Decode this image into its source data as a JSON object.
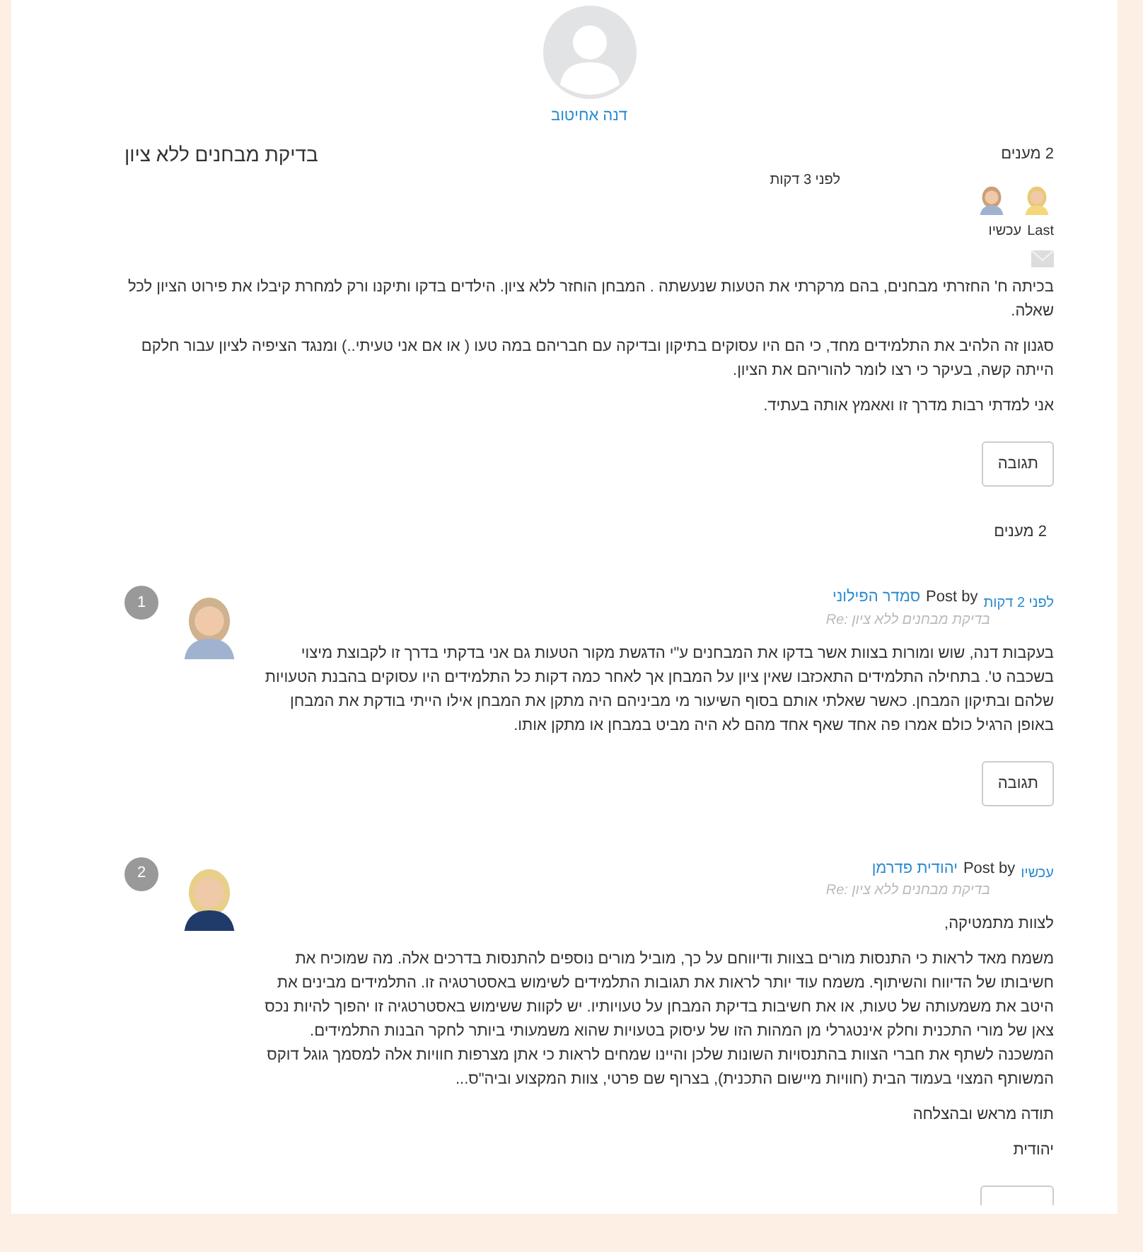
{
  "topic": {
    "author_name": "דנה אחיטוב",
    "title": "בדיקת מבחנים ללא ציון",
    "replies_count": "2 מענים",
    "time": "לפני 3 דקות",
    "last_label": "Last",
    "last_time": "עכשיו",
    "paragraphs": [
      "בכיתה ח' החזרתי מבחנים, בהם מרקרתי את הטעות שנעשתה . המבחן הוחזר ללא ציון. הילדים בדקו ותיקנו ורק למחרת קיבלו את פירוט הציון לכל שאלה.",
      "סגנון זה הלהיב את התלמידים מחד, כי הם היו עסוקים בתיקון ובדיקה עם חבריהם במה טעו ( או אם אני טעיתי..) ומנגד הציפיה לציון עבור חלקם הייתה קשה, בעיקר כי רצו לומר להוריהם את הציון.",
      "אני למדתי רבות מדרך זו ואאמץ אותה בעתיד."
    ],
    "reply_button": "תגובה"
  },
  "replies_heading": "2 מענים",
  "posts": [
    {
      "number": "1",
      "time": "לפני 2 דקות",
      "by": "Post by",
      "author": "סמדר הפילוני",
      "subject": "Re: בדיקת מבחנים ללא ציון",
      "paragraphs": [
        "בעקבות דנה, שוש ומורות בצוות אשר בדקו את המבחנים ע\"י הדגשת מקור הטעות גם אני בדקתי בדרך זו לקבוצת מיצוי בשכבה ט'. בתחילה התלמידים התאכזבו שאין ציון על המבחן אך לאחר כמה דקות כל התלמידים היו עסוקים בהבנת הטעויות שלהם ובתיקון המבחן. כאשר שאלתי אותם בסוף השיעור מי מביניהם  היה מתקן את המבחן אילו הייתי בודקת את המבחן באופן הרגיל כולם אמרו פה אחד שאף אחד מהם לא היה מביט במבחן או מתקן אותו."
      ],
      "reply_button": "תגובה"
    },
    {
      "number": "2",
      "time": "עכשיו",
      "by": "Post by",
      "author": "יהודית פדרמן",
      "subject": "Re: בדיקת מבחנים ללא ציון",
      "paragraphs": [
        "לצוות מתמטיקה,",
        "משמח מאד לראות כי התנסות מורים בצוות ודיווחם על כך, מוביל מורים נוספים להתנסות בדרכים אלה. מה שמוכיח את חשיבותו של הדיווח והשיתוף. משמח עוד יותר לראות את תגובות התלמידים לשימוש באסטרטגיה זו. התלמידים מבינים את היטב את משמעותה של טעות, או את חשיבות בדיקת המבחן על טעויותיו. יש לקוות ששימוש באסטרטגיה זו יהפוך להיות נכס צאן של מורי התכנית וחלק אינטגרלי מן המהות הזו של עיסוק בטעויות שהוא משמעותי ביותר לחקר הבנות התלמידים. המשכנה לשתף את חברי הצוות בהתנסויות השונות שלכן והיינו שמחים לראות כי אתן מצרפות חוויות אלה למסמך גוגל דוקס המשותף המצוי בעמוד הבית (חוויות מיישום התכנית), בצרוף שם פרטי, צוות המקצוע וביה\"ס...",
        "תודה מראש ובהצלחה",
        "יהודית"
      ],
      "reply_button_stub": true
    }
  ]
}
